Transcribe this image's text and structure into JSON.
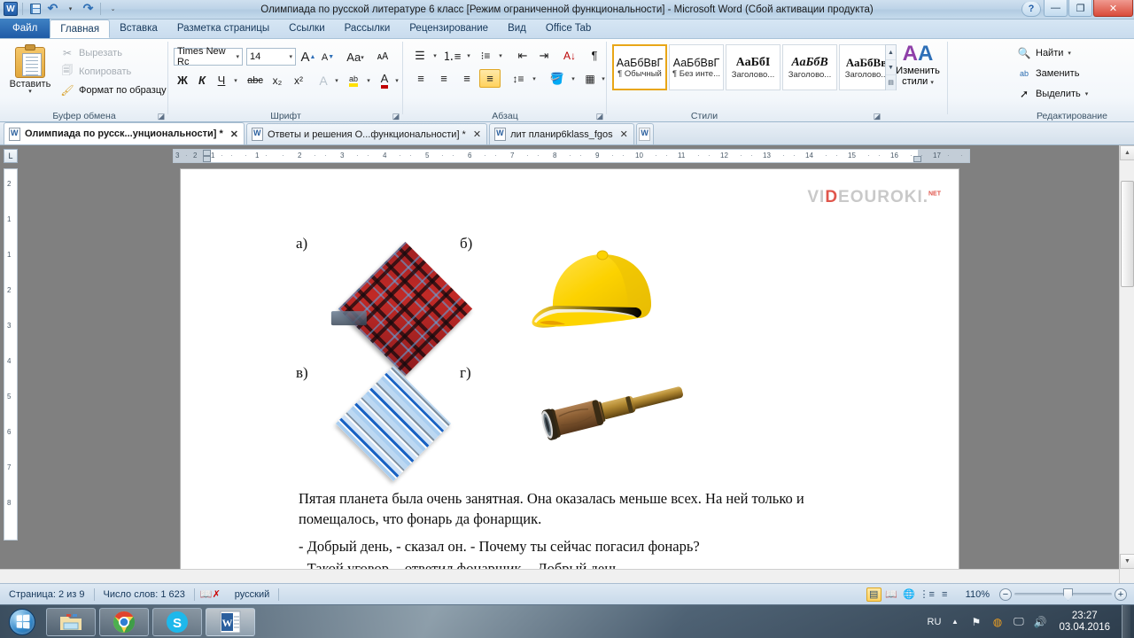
{
  "titlebar": {
    "title": "Олимпиада по русской литературе 6 класс [Режим ограниченной функциональности]  -  Microsoft Word (Сбой активации продукта)",
    "app_badge": "W",
    "quick_access": [
      "save-icon",
      "undo-icon",
      "redo-icon",
      "customize-icon"
    ],
    "window_buttons": {
      "help": "?",
      "minimize": "—",
      "restore": "❐",
      "close": "✕"
    }
  },
  "ribbon_tabs": [
    {
      "label": "Файл",
      "kind": "file"
    },
    {
      "label": "Главная",
      "kind": "active"
    },
    {
      "label": "Вставка",
      "kind": "normal"
    },
    {
      "label": "Разметка страницы",
      "kind": "normal"
    },
    {
      "label": "Ссылки",
      "kind": "normal"
    },
    {
      "label": "Рассылки",
      "kind": "normal"
    },
    {
      "label": "Рецензирование",
      "kind": "normal"
    },
    {
      "label": "Вид",
      "kind": "normal"
    },
    {
      "label": "Office Tab",
      "kind": "normal"
    }
  ],
  "ribbon": {
    "clipboard": {
      "group_label": "Буфер обмена",
      "paste_label": "Вставить",
      "cut_label": "Вырезать",
      "copy_label": "Копировать",
      "format_painter_label": "Формат по образцу"
    },
    "font": {
      "group_label": "Шрифт",
      "font_name": "Times New Rc",
      "font_size": "14",
      "grow_label": "A",
      "shrink_label": "A",
      "case_label": "Aa",
      "clear_label": "ab",
      "bold_label": "Ж",
      "italic_label": "К",
      "underline_label": "Ч",
      "strike_label": "abc",
      "subscript_label": "x₂",
      "superscript_label": "x²",
      "text_effects_label": "A",
      "highlight_label": "ab",
      "font_color_label": "A"
    },
    "paragraph": {
      "group_label": "Абзац",
      "bullets": "bullet-list-icon",
      "numbering": "numbered-list-icon",
      "multilevel": "multilevel-list-icon",
      "decrease_indent": "decrease-indent-icon",
      "increase_indent": "increase-indent-icon",
      "sort": "sort-icon",
      "marks": "¶",
      "align_left": "align-left-icon",
      "align_center": "align-center-icon",
      "align_right": "align-right-icon",
      "align_justify": "align-justify-icon",
      "line_spacing": "line-spacing-icon",
      "shading": "shading-icon",
      "borders": "borders-icon"
    },
    "styles": {
      "group_label": "Стили",
      "items": [
        {
          "preview": "АаБбВвГ",
          "name": "¶ Обычный",
          "selected": true
        },
        {
          "preview": "АаБбВвГ",
          "name": "¶ Без инте...",
          "selected": false
        },
        {
          "preview": "АаБбІ",
          "name": "Заголово...",
          "selected": false
        },
        {
          "preview": "АаБбВ",
          "name": "Заголово...",
          "selected": false
        },
        {
          "preview": "АаБбВв",
          "name": "Заголово...",
          "selected": false
        }
      ],
      "change_styles_label_1": "Изменить",
      "change_styles_label_2": "стили"
    },
    "editing": {
      "group_label": "Редактирование",
      "find_label": "Найти",
      "replace_label": "Заменить",
      "select_label": "Выделить"
    }
  },
  "doc_tabs": [
    {
      "label": "Олимпиада по русск...унциональности] *",
      "active": true
    },
    {
      "label": "Ответы и решения О...функциональности] *",
      "active": false
    },
    {
      "label": "лит планир6klass_fgos",
      "active": false
    }
  ],
  "ruler": {
    "left_ticks": [
      "3",
      "2",
      "1"
    ],
    "right_ticks": [
      "1",
      "2",
      "3",
      "4",
      "5",
      "6",
      "7",
      "8",
      "9",
      "10",
      "11",
      "12",
      "13",
      "14",
      "15",
      "16",
      "17"
    ]
  },
  "document": {
    "watermark": {
      "part1": "VI",
      "part2": "D",
      "part3": "EOUROKI.",
      "sup": "NET"
    },
    "image_labels": [
      {
        "id": "a",
        "text": "а)"
      },
      {
        "id": "b",
        "text": "б)"
      },
      {
        "id": "v",
        "text": "в)"
      },
      {
        "id": "g",
        "text": "г)"
      }
    ],
    "images": [
      {
        "id": "a",
        "alt": "red-plaid-handkerchief"
      },
      {
        "id": "b",
        "alt": "yellow-baseball-cap"
      },
      {
        "id": "v",
        "alt": "blue-striped-handkerchief"
      },
      {
        "id": "g",
        "alt": "brass-spyglass-telescope"
      }
    ],
    "paragraphs": [
      "Пятая планета была очень занятная. Она оказалась меньше всех. На ней только и помещалось, что фонарь да фонарщик.",
      "- Добрый день, - сказал он. - Почему ты сейчас погасил фонарь?",
      "- Такой уговор, - ответил фонарщик. - Добрый день."
    ]
  },
  "statusbar": {
    "page": "Страница: 2 из 9",
    "words": "Число слов: 1 623",
    "proofing_icon": "spellcheck-icon",
    "language": "русский",
    "views": [
      "print-layout-icon",
      "full-screen-reading-icon",
      "web-layout-icon",
      "outline-icon",
      "draft-icon"
    ],
    "zoom": "110%",
    "zoom_out": "−",
    "zoom_in": "+"
  },
  "taskbar": {
    "start": "start-orb-icon",
    "apps": [
      {
        "name": "explorer-icon",
        "active": false
      },
      {
        "name": "chrome-icon",
        "active": false
      },
      {
        "name": "skype-icon",
        "active": false
      },
      {
        "name": "word-icon",
        "active": true
      }
    ],
    "tray": {
      "language": "RU",
      "icons": [
        "show-hidden-icon",
        "network-flag-icon",
        "update-icon",
        "display-icon",
        "volume-icon"
      ],
      "time": "23:27",
      "date": "03.04.2016"
    }
  }
}
